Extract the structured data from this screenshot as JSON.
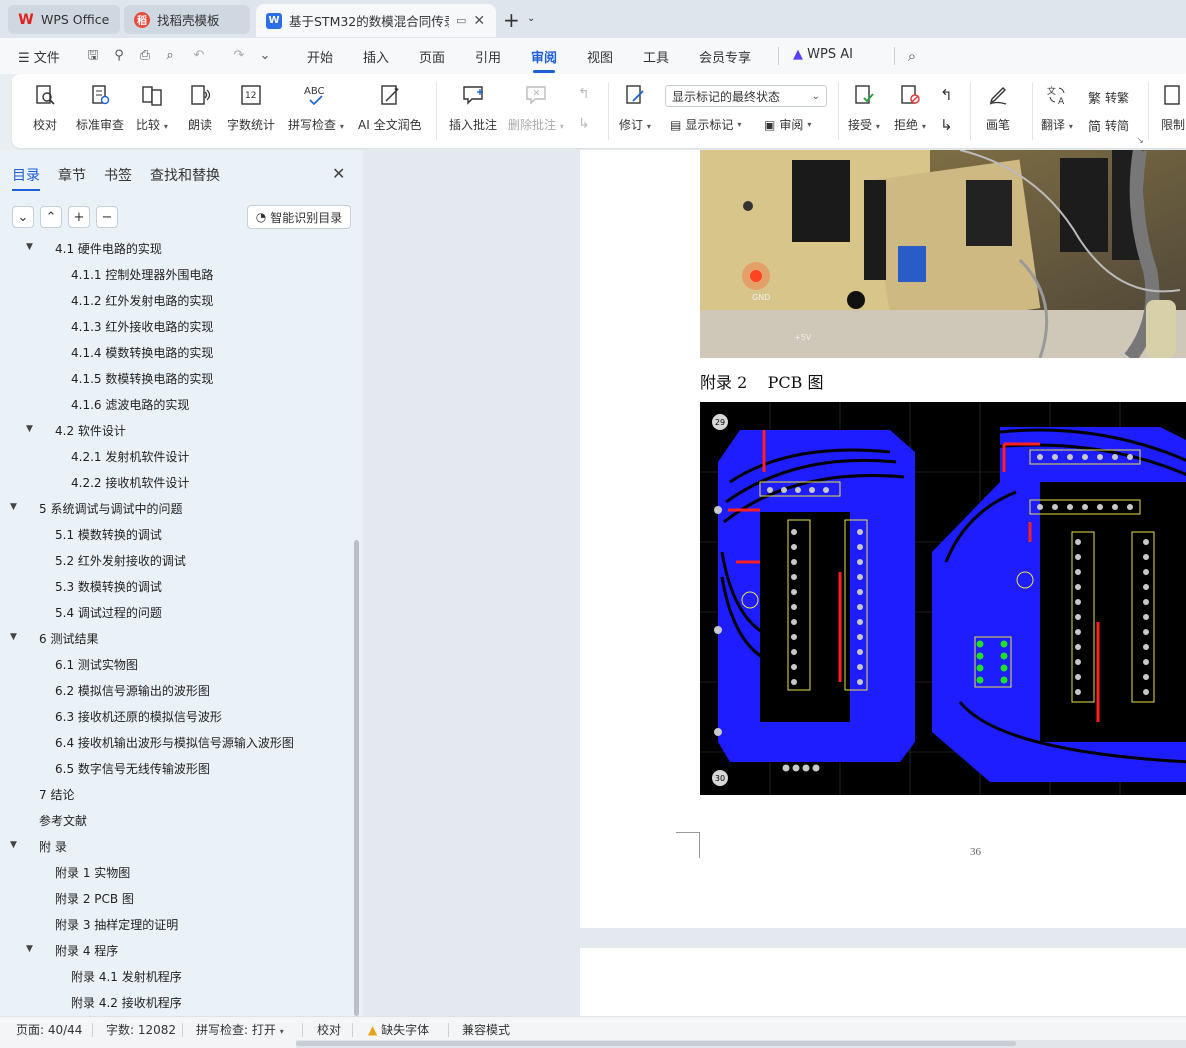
{
  "tabs": [
    {
      "label": "WPS Office",
      "icon": "wps-logo-icon"
    },
    {
      "label": "找稻壳模板",
      "icon": "docer-icon"
    },
    {
      "label": "基于STM32的数模混合同传录",
      "icon": "word-doc-icon"
    }
  ],
  "menubar": {
    "file": "文件",
    "items": [
      "开始",
      "插入",
      "页面",
      "引用",
      "审阅",
      "视图",
      "工具",
      "会员专享"
    ],
    "selected": "审阅",
    "wps_ai": "WPS AI"
  },
  "ribbon": {
    "proofread": "校对",
    "standard_review": "标准审查",
    "compare": "比较",
    "read_aloud": "朗读",
    "word_count": "字数统计",
    "spell_check": "拼写检查",
    "ai_polish": "AI 全文润色",
    "insert_comment": "插入批注",
    "delete_comment": "删除批注",
    "track_changes": "修订",
    "display_mode": "显示标记的最终状态",
    "show_markup": "显示标记",
    "review": "审阅",
    "accept": "接受",
    "reject": "拒绝",
    "pen": "画笔",
    "translate": "翻译",
    "to_traditional": "转繁",
    "to_simplified": "转简",
    "restrict": "限制"
  },
  "nav": {
    "tabs": [
      "目录",
      "章节",
      "书签",
      "查找和替换"
    ],
    "selected_tab": "目录",
    "smart_toc": "智能识别目录",
    "toc": [
      {
        "text": "4.1  硬件电路的实现",
        "level": 2,
        "expand": "open"
      },
      {
        "text": "4.1.1  控制处理器外围电路",
        "level": 3
      },
      {
        "text": "4.1.2  红外发射电路的实现",
        "level": 3
      },
      {
        "text": "4.1.3  红外接收电路的实现",
        "level": 3
      },
      {
        "text": "4.1.4  模数转换电路的实现",
        "level": 3
      },
      {
        "text": "4.1.5 数模转换电路的实现",
        "level": 3
      },
      {
        "text": "4.1.6 滤波电路的实现",
        "level": 3
      },
      {
        "text": "4.2  软件设计",
        "level": 2,
        "expand": "open"
      },
      {
        "text": "4.2.1  发射机软件设计",
        "level": 3
      },
      {
        "text": "4.2.2  接收机软件设计",
        "level": 3
      },
      {
        "text": "5  系统调试与调试中的问题",
        "level": 1,
        "expand": "open"
      },
      {
        "text": "5.1  模数转换的调试",
        "level": 2
      },
      {
        "text": "5.2  红外发射接收的调试",
        "level": 2
      },
      {
        "text": "5.3  数模转换的调试",
        "level": 2
      },
      {
        "text": "5.4  调试过程的问题",
        "level": 2
      },
      {
        "text": "6  测试结果",
        "level": 1,
        "expand": "open"
      },
      {
        "text": "6.1  测试实物图",
        "level": 2
      },
      {
        "text": "6.2  模拟信号源输出的波形图",
        "level": 2
      },
      {
        "text": "6.3  接收机还原的模拟信号波形",
        "level": 2
      },
      {
        "text": "6.4  接收机输出波形与模拟信号源输入波形图",
        "level": 2
      },
      {
        "text": "6.5  数字信号无线传输波形图",
        "level": 2
      },
      {
        "text": "7  结论",
        "level": 1
      },
      {
        "text": "参考文献",
        "level": 1
      },
      {
        "text": "附  录",
        "level": 1,
        "expand": "open"
      },
      {
        "text": "附录 1  实物图",
        "level": 2
      },
      {
        "text": "附录 2    PCB 图",
        "level": 2
      },
      {
        "text": "附录 3  抽样定理的证明",
        "level": 2
      },
      {
        "text": "附录 4  程序",
        "level": 2,
        "expand": "open"
      },
      {
        "text": "附录 4.1  发射机程序",
        "level": 3
      },
      {
        "text": "附录 4.2  接收机程序",
        "level": 3
      }
    ]
  },
  "document": {
    "appendix_title": "附录 2    PCB 图",
    "page_number": "36",
    "pcb_labels": [
      "29",
      "30"
    ],
    "photo_labels": [
      "GND",
      "+5V"
    ]
  },
  "status": {
    "page": "页面: 40/44",
    "words": "字数: 12082",
    "spell": "拼写检查: 打开",
    "proof": "校对",
    "missing_font": "缺失字体",
    "compat": "兼容模式"
  },
  "colors": {
    "accent": "#1f5fd6",
    "pcb_copper": "#1d1dff",
    "pcb_background": "#000000"
  }
}
